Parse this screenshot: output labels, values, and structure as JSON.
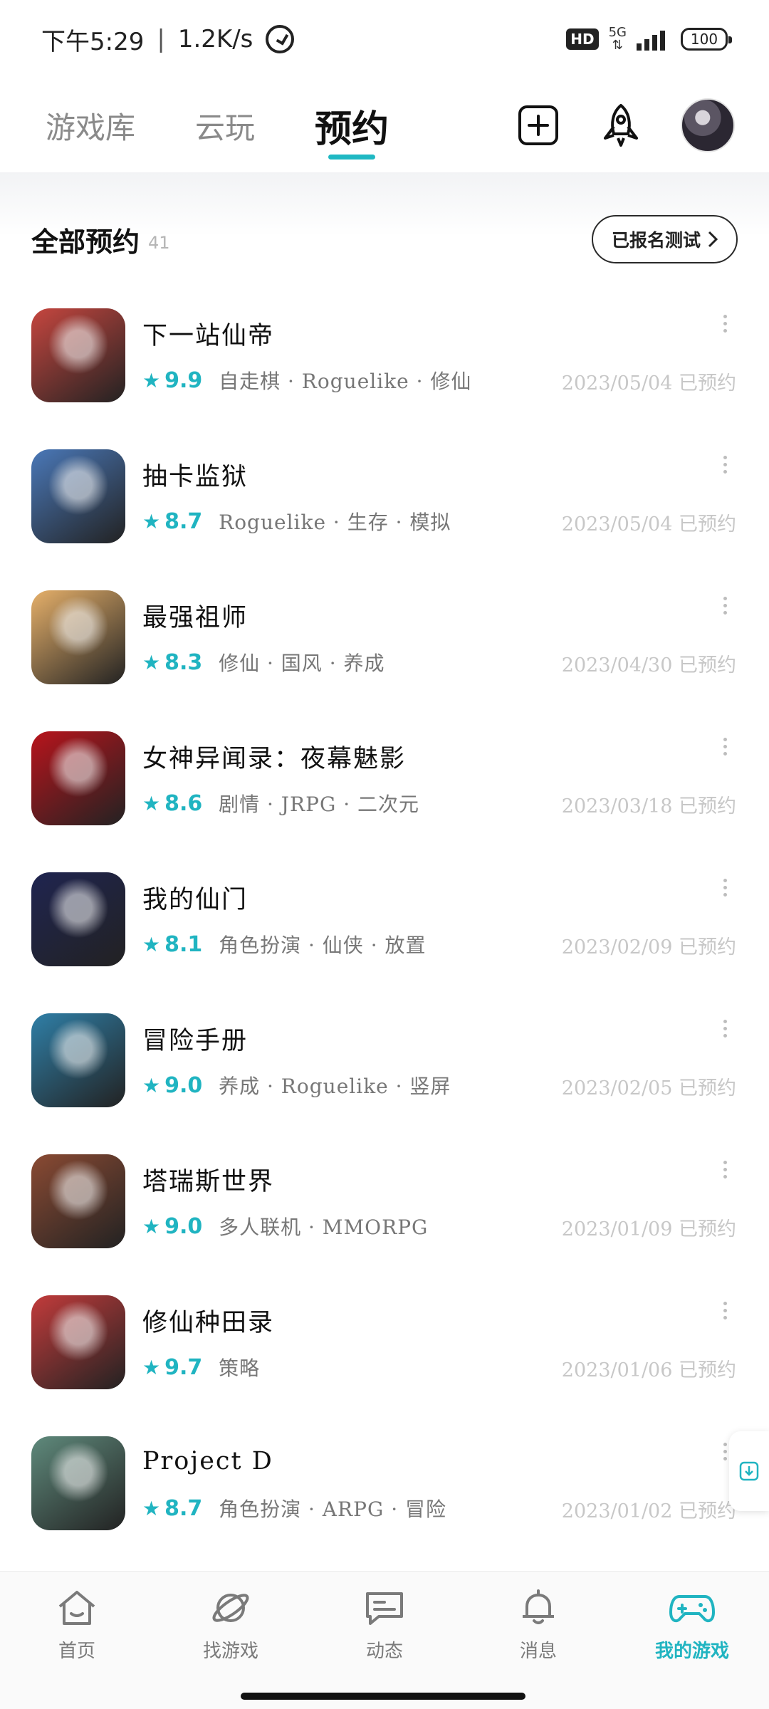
{
  "status_bar": {
    "time": "下午5:29",
    "separator": "|",
    "net_speed": "1.2K/s",
    "hd_badge": "HD",
    "network": "5G",
    "battery": "100"
  },
  "top_nav": {
    "tabs": [
      {
        "label": "游戏库"
      },
      {
        "label": "云玩"
      },
      {
        "label": "预约"
      }
    ],
    "active_tab": "预约"
  },
  "section": {
    "title": "全部预约",
    "count": "41",
    "test_button": "已报名测试"
  },
  "games": [
    {
      "title": "下一站仙帝",
      "rating": "9.9",
      "tags": "自走棋 · Roguelike · 修仙",
      "date": "2023/05/04",
      "status": "已预约",
      "icon_color": "#c6463f"
    },
    {
      "title": "抽卡监狱",
      "rating": "8.7",
      "tags": "Roguelike · 生存 · 模拟",
      "date": "2023/05/04",
      "status": "已预约",
      "icon_color": "#4a78b8"
    },
    {
      "title": "最强祖师",
      "rating": "8.3",
      "tags": "修仙 · 国风 · 养成",
      "date": "2023/04/30",
      "status": "已预约",
      "icon_color": "#e6b06a"
    },
    {
      "title": "女神异闻录：夜幕魅影",
      "rating": "8.6",
      "tags": "剧情 · JRPG · 二次元",
      "date": "2023/03/18",
      "status": "已预约",
      "icon_color": "#b8141c"
    },
    {
      "title": "我的仙门",
      "rating": "8.1",
      "tags": "角色扮演 · 仙侠 · 放置",
      "date": "2023/02/09",
      "status": "已预约",
      "icon_color": "#1f2450"
    },
    {
      "title": "冒险手册",
      "rating": "9.0",
      "tags": "养成 · Roguelike · 竖屏",
      "date": "2023/02/05",
      "status": "已预约",
      "icon_color": "#2f7fa7"
    },
    {
      "title": "塔瑞斯世界",
      "rating": "9.0",
      "tags": "多人联机 · MMORPG",
      "date": "2023/01/09",
      "status": "已预约",
      "icon_color": "#8a4a33"
    },
    {
      "title": "修仙种田录",
      "rating": "9.7",
      "tags": "策略",
      "date": "2023/01/06",
      "status": "已预约",
      "icon_color": "#c23b3b"
    },
    {
      "title": "Project D",
      "rating": "8.7",
      "tags": "角色扮演 · ARPG · 冒险",
      "date": "2023/01/02",
      "status": "已预约",
      "icon_color": "#5f8a7c"
    }
  ],
  "bottom_nav": {
    "items": [
      {
        "label": "首页",
        "icon": "home-icon"
      },
      {
        "label": "找游戏",
        "icon": "planet-icon"
      },
      {
        "label": "动态",
        "icon": "chat-icon"
      },
      {
        "label": "消息",
        "icon": "bell-icon"
      },
      {
        "label": "我的游戏",
        "icon": "gamepad-icon"
      }
    ],
    "active": "我的游戏"
  },
  "colors": {
    "accent": "#20b4c1"
  }
}
